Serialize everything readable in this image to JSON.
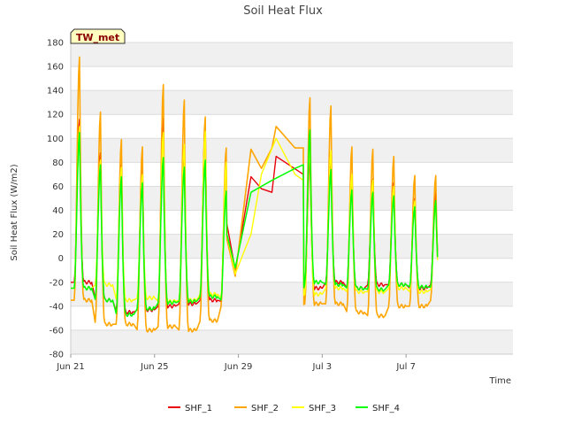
{
  "chart_data": {
    "type": "line",
    "title": "Soil Heat Flux",
    "xlabel": "Time",
    "ylabel": "Soil Heat Flux (W/m2)",
    "site_tag": "TW_met",
    "x_unit": "days since Jun 21",
    "xlim": [
      0,
      21.1
    ],
    "ylim": [
      -80,
      180
    ],
    "yticks": [
      -80,
      -60,
      -40,
      -20,
      0,
      20,
      40,
      60,
      80,
      100,
      120,
      140,
      160,
      180
    ],
    "xticks": [
      {
        "value": 0,
        "label": "Jun 21"
      },
      {
        "value": 4,
        "label": "Jun 25"
      },
      {
        "value": 8,
        "label": "Jun 29"
      },
      {
        "value": 12,
        "label": "Jul 3"
      },
      {
        "value": 16,
        "label": "Jul 7"
      }
    ],
    "grid": "horizontal bands",
    "legend_position": "bottom",
    "days": [
      0,
      1,
      2,
      3,
      4,
      5,
      6,
      7,
      11,
      12,
      13,
      14,
      15,
      16,
      17
    ],
    "gap_segments": [
      {
        "x": [
          7.45,
          7.85
        ],
        "note": "link"
      },
      {
        "x": [
          7.85,
          9.6,
          10.7,
          11.1
        ]
      }
    ],
    "series": [
      {
        "name": "SHF_1",
        "color": "#e8000b",
        "day_peaks": [
          116,
          88,
          78,
          80,
          117,
          92,
          113,
          80,
          85,
          83,
          67,
          66,
          63,
          50,
          57
        ],
        "day_troughs": [
          -20,
          -35,
          -45,
          -43,
          -40,
          -38,
          -35,
          -36,
          -25,
          -20,
          -25,
          -22,
          -22,
          -25,
          -22
        ],
        "bridge": [
          [
            7.45,
            29
          ],
          [
            7.85,
            -10
          ],
          [
            8.6,
            68
          ],
          [
            9.1,
            58
          ],
          [
            9.6,
            55
          ],
          [
            9.8,
            85
          ],
          [
            11.1,
            70
          ]
        ],
        "line_width": 1.4
      },
      {
        "name": "SHF_2",
        "color": "#ffa500",
        "day_peaks": [
          168,
          122,
          99,
          93,
          145,
          132,
          118,
          92,
          134,
          127,
          93,
          91,
          85,
          69,
          69
        ],
        "day_troughs": [
          -35,
          -55,
          -55,
          -60,
          -57,
          -60,
          -52,
          -40,
          -38,
          -38,
          -45,
          -48,
          -40,
          -40,
          -35
        ],
        "bridge": [
          [
            7.45,
            16
          ],
          [
            7.85,
            -15
          ],
          [
            8.6,
            91
          ],
          [
            9.1,
            75
          ],
          [
            9.6,
            92
          ],
          [
            9.8,
            110
          ],
          [
            10.7,
            92
          ],
          [
            11.1,
            92
          ]
        ],
        "line_width": 1.6
      },
      {
        "name": "SHF_3",
        "color": "#ffff00",
        "day_peaks": [
          110,
          82,
          76,
          70,
          105,
          95,
          106,
          80,
          95,
          90,
          70,
          65,
          60,
          48,
          45
        ],
        "day_troughs": [
          -25,
          -22,
          -35,
          -33,
          -36,
          -35,
          -30,
          -33,
          -30,
          -25,
          -28,
          -28,
          -25,
          -28,
          -26
        ],
        "bridge": [
          [
            7.45,
            20
          ],
          [
            7.85,
            -13
          ],
          [
            8.6,
            20
          ],
          [
            9.1,
            70
          ],
          [
            9.8,
            100
          ],
          [
            10.7,
            70
          ],
          [
            11.1,
            65
          ]
        ],
        "line_width": 1.4
      },
      {
        "name": "SHF_4",
        "color": "#00ff00",
        "day_peaks": [
          105,
          78,
          68,
          63,
          84,
          76,
          82,
          56,
          107,
          74,
          57,
          55,
          52,
          43,
          48
        ],
        "day_troughs": [
          -25,
          -35,
          -47,
          -42,
          -37,
          -36,
          -32,
          -35,
          -20,
          -22,
          -25,
          -26,
          -22,
          -24,
          -24
        ],
        "bridge": [
          [
            7.45,
            20
          ],
          [
            7.85,
            -8
          ],
          [
            8.6,
            55
          ],
          [
            9.6,
            65
          ],
          [
            10.7,
            75
          ],
          [
            11.1,
            78
          ]
        ],
        "line_width": 1.5
      }
    ]
  }
}
